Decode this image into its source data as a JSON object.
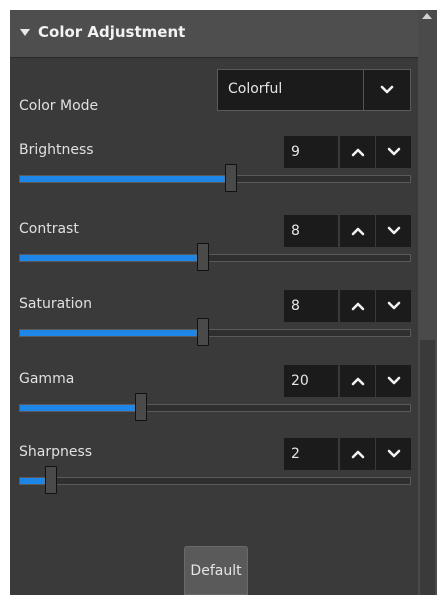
{
  "header": {
    "title": "Color Adjustment",
    "icon": "triangle-down-icon"
  },
  "scrollbar": {
    "up_icon": "scroll-up-arrow-icon"
  },
  "color_mode": {
    "label": "Color Mode",
    "value": "Colorful",
    "dropdown_icon": "chevron-down-icon"
  },
  "settings": [
    {
      "label": "Brightness",
      "value": "9",
      "level": 0.54
    },
    {
      "label": "Contrast",
      "value": "8",
      "level": 0.47
    },
    {
      "label": "Saturation",
      "value": "8",
      "level": 0.47
    },
    {
      "label": "Gamma",
      "value": "20",
      "level": 0.31
    },
    {
      "label": "Sharpness",
      "value": "2",
      "level": 0.08
    }
  ],
  "default_button": {
    "label": "Default"
  },
  "colors": {
    "panel": "#3a3a3a",
    "header": "#4e4e4e",
    "field": "#1b1b1b",
    "accent": "#1e86e6"
  }
}
